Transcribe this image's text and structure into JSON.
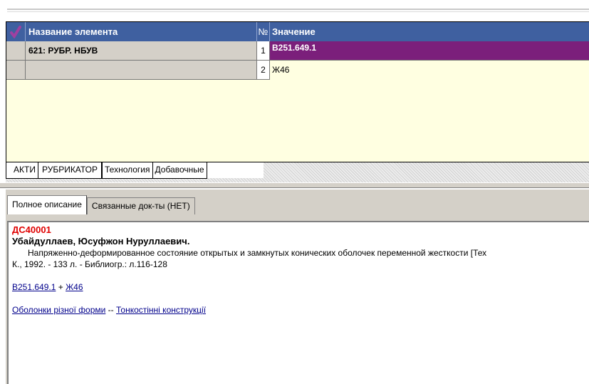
{
  "grid": {
    "headers": {
      "check": "✔",
      "name": "Название элемента",
      "num": "№",
      "value": "Значение"
    },
    "rows": [
      {
        "name": "621: РУБР. НБУВ",
        "num": "1",
        "value": "В251.649.1"
      },
      {
        "name": "",
        "num": "2",
        "value": "Ж46"
      }
    ]
  },
  "tabs": [
    "АКТИ",
    "РУБРИКАТОР",
    "Технология",
    "Добавочные"
  ],
  "active_tab": "РУБРИКАТОР",
  "bottom_tabs": [
    "Полное описание",
    "Связанные док-ты (НЕТ)"
  ],
  "document": {
    "id": "ДС40001",
    "author": "Убайдуллаев, Юсуфжон Нуруллаевич.",
    "title_line": "Напряженно-деформированное состояние открытых и замкнутых конических оболочек переменной жесткости [Тех",
    "imprint": "К., 1992. - 133 л. - Библиогр.: л.116-128",
    "class_links": [
      "В251.649.1",
      "Ж46"
    ],
    "class_sep": "+",
    "subject_links": [
      "Оболонки різної форми",
      "Тонкостінні конструкції"
    ],
    "subject_sep": "--"
  },
  "colors": {
    "header": "#3f60a0",
    "selected": "#7b1f7b",
    "grid_bg": "#ffffe1",
    "check": "#a040a0",
    "doc_id": "#e00000"
  }
}
